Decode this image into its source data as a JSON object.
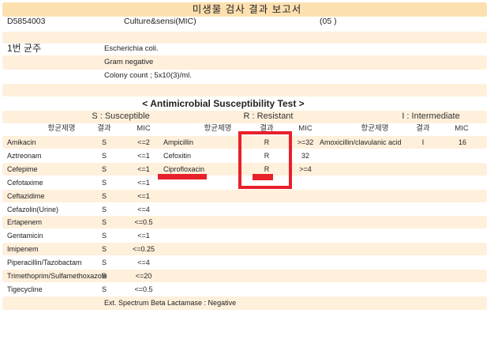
{
  "report_title": "미생물 검사 결과 보고서",
  "specimen_id": "D5854003",
  "test_name": "Culture&sensi(MIC)",
  "test_code": "(05 )",
  "isolate_label": "1번 균주",
  "organism": "Escherichia coli.",
  "gram": "Gram negative",
  "colony_count": "Colony count ; 5x10(3)/ml.",
  "ast_title": "< Antimicrobial Susceptibility Test >",
  "legend": {
    "s": "S : Susceptible",
    "r": "R : Resistant",
    "i": "I : Intermediate"
  },
  "headers": {
    "drug": "항균제명",
    "result": "결과",
    "mic": "MIC"
  },
  "col1": [
    {
      "drug": "Amikacin",
      "result": "S",
      "mic": "<=2"
    },
    {
      "drug": "Aztreonam",
      "result": "S",
      "mic": "<=1"
    },
    {
      "drug": "Cefepime",
      "result": "S",
      "mic": "<=1"
    },
    {
      "drug": "Cefotaxime",
      "result": "S",
      "mic": "<=1"
    },
    {
      "drug": "Ceftazidime",
      "result": "S",
      "mic": "<=1"
    },
    {
      "drug": "Cefazolin(Urine)",
      "result": "S",
      "mic": "<=4"
    },
    {
      "drug": "Ertapenem",
      "result": "S",
      "mic": "<=0.5"
    },
    {
      "drug": "Gentamicin",
      "result": "S",
      "mic": "<=1"
    },
    {
      "drug": "Imipenem",
      "result": "S",
      "mic": "<=0.25"
    },
    {
      "drug": "Piperacillin/Tazobactam",
      "result": "S",
      "mic": "<=4"
    },
    {
      "drug": "Trimethoprim/Sulfamethoxazole",
      "result": "S",
      "mic": "<=20"
    },
    {
      "drug": "Tigecycline",
      "result": "S",
      "mic": "<=0.5"
    }
  ],
  "col2": [
    {
      "drug": "Ampicillin",
      "result": "R",
      "mic": ">=32"
    },
    {
      "drug": "Cefoxitin",
      "result": "R",
      "mic": "32"
    },
    {
      "drug": "Ciprofloxacin",
      "result": "R",
      "mic": ">=4"
    }
  ],
  "col3": [
    {
      "drug": "Amoxicillin/clavulanic acid",
      "result": "I",
      "mic": "16"
    }
  ],
  "esbl": "Ext. Spectrum Beta Lactamase : Negative",
  "annotation_color": "#e8202a"
}
